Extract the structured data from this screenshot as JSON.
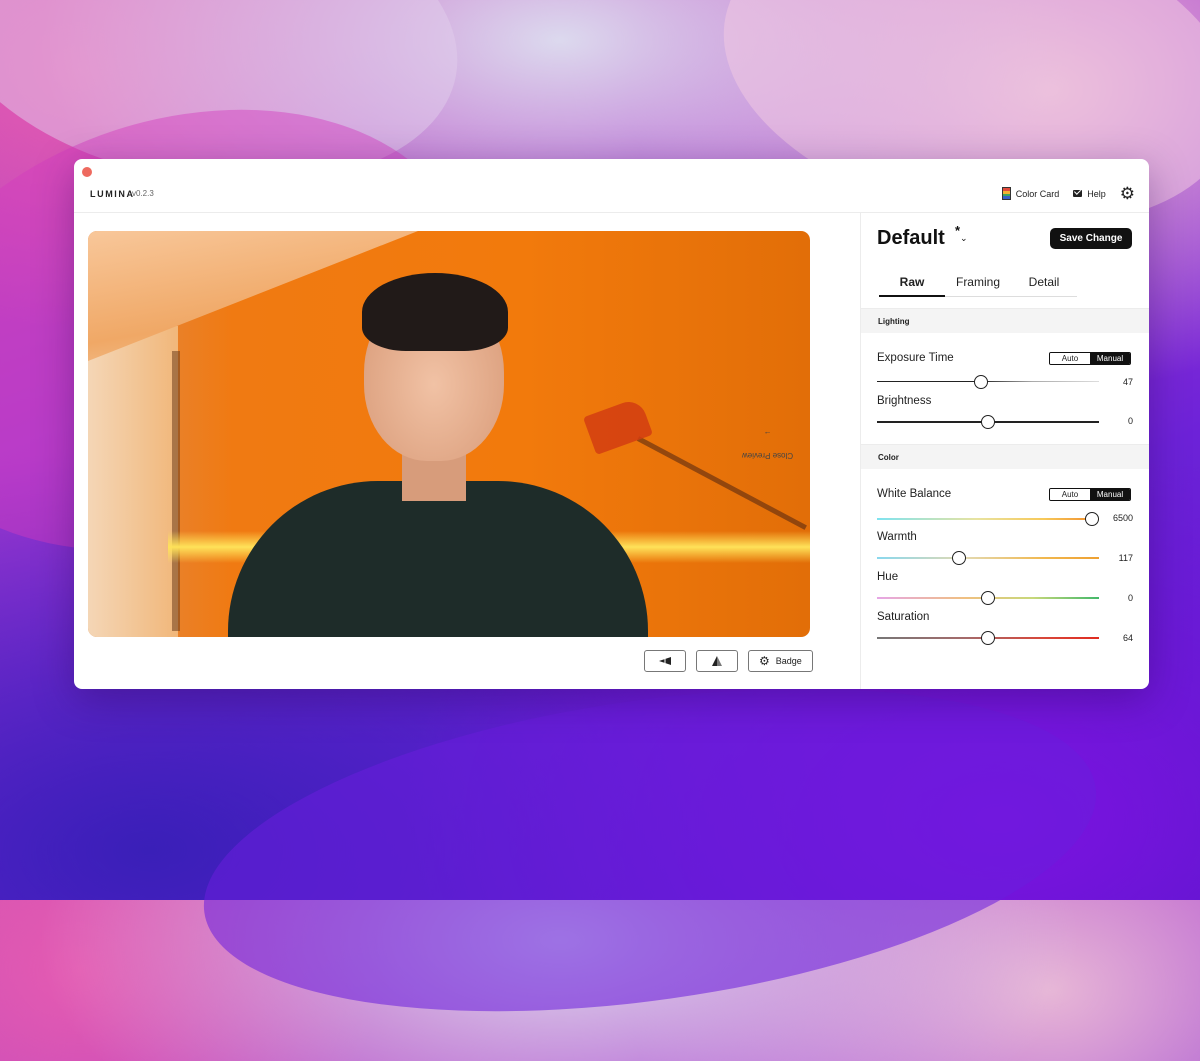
{
  "app": {
    "name": "LUMINA",
    "version": "v0.2.3"
  },
  "topbar": {
    "color_card_label": "Color Card",
    "help_label": "Help"
  },
  "preview": {
    "close_preview_label": "Close Preview",
    "close_arrow": "→",
    "badge_label": "Badge"
  },
  "panel": {
    "preset_name": "Default",
    "modified_marker": "*",
    "save_label": "Save Change",
    "tabs": [
      {
        "label": "Raw",
        "active": true
      },
      {
        "label": "Framing",
        "active": false
      },
      {
        "label": "Detail",
        "active": false
      }
    ],
    "lighting": {
      "section_label": "Lighting",
      "exposure": {
        "label": "Exposure Time",
        "value": "47",
        "mode_auto": "Auto",
        "mode_manual": "Manual",
        "selected_mode": "Manual"
      },
      "brightness": {
        "label": "Brightness",
        "value": "0"
      }
    },
    "color": {
      "section_label": "Color",
      "white_balance": {
        "label": "White Balance",
        "value": "6500",
        "mode_auto": "Auto",
        "mode_manual": "Manual",
        "selected_mode": "Manual"
      },
      "warmth": {
        "label": "Warmth",
        "value": "117"
      },
      "hue": {
        "label": "Hue",
        "value": "0"
      },
      "saturation": {
        "label": "Saturation",
        "value": "64"
      }
    }
  },
  "colors": {
    "accent": "#111111",
    "close_dot": "#ee6a5f",
    "video_wall": "#f27a0c"
  },
  "icons": [
    "color-card-icon",
    "mail-icon",
    "gear-icon",
    "flip-horizontal-icon",
    "flip-vertical-icon",
    "badge-gear-icon",
    "chevron-down-icon"
  ]
}
